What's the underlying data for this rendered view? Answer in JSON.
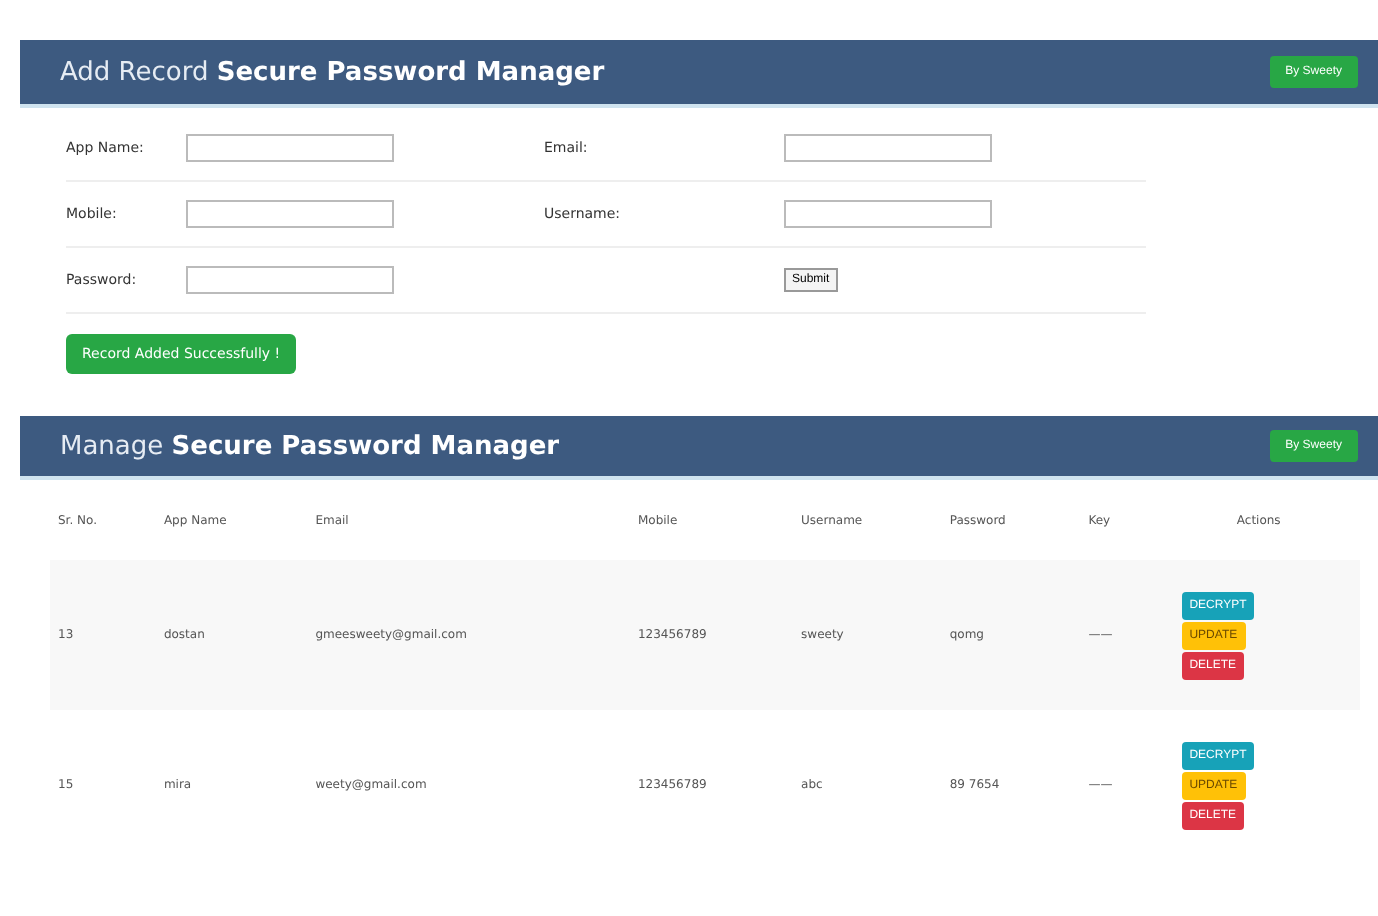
{
  "add_panel": {
    "title_light": "Add Record",
    "title_bold": "Secure Password Manager",
    "badge": "By Sweety"
  },
  "form": {
    "fields": [
      {
        "label": "App Name:"
      },
      {
        "label": "Email:"
      },
      {
        "label": "Mobile:"
      },
      {
        "label": "Username:"
      },
      {
        "label": "Password:"
      }
    ],
    "submit": "Submit",
    "message": "Record Added Successfully !"
  },
  "manage_panel": {
    "title_light": "Manage",
    "title_bold": "Secure Password Manager",
    "badge": "By Sweety"
  },
  "table": {
    "columns": [
      "Sr. No.",
      "App Name",
      "Email",
      "Mobile",
      "Username",
      "Password",
      "Key",
      "Actions"
    ],
    "rows": [
      {
        "cells": [
          "13",
          "dostan",
          "gmeesweety@gmail.com",
          "123456789",
          "sweety",
          "qomg",
          "——"
        ],
        "actions": [
          {
            "label": "DECRYPT",
            "kind": "info"
          },
          {
            "label": "UPDATE",
            "kind": "warning"
          },
          {
            "label": "DELETE",
            "kind": "danger"
          }
        ]
      },
      {
        "cells": [
          "15",
          "mira",
          "weety@gmail.com",
          "123456789",
          "abc",
          "89 7654",
          "——"
        ],
        "actions": [
          {
            "label": "DECRYPT",
            "kind": "info"
          },
          {
            "label": "UPDATE",
            "kind": "warning"
          },
          {
            "label": "DELETE",
            "kind": "danger"
          }
        ]
      }
    ]
  }
}
